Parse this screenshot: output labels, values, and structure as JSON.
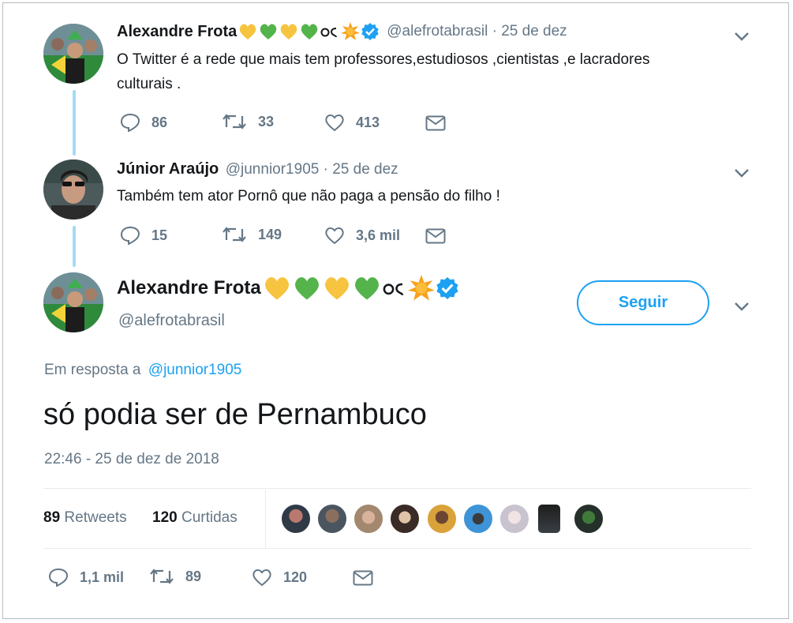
{
  "tweet1": {
    "name": "Alexandre Frota",
    "handle_date": "@alefrotabrasil · 25 de dez",
    "text_line1": "O Twitter é a rede que mais tem professores,estudiosos ,cientistas ,e lacradores",
    "text_line2": "culturais .",
    "replies": "86",
    "retweets": "33",
    "likes": "413"
  },
  "tweet2": {
    "name": "Júnior Araújo",
    "handle_date": "@junnior1905 · 25 de dez",
    "text": "Também tem ator Pornô que não paga a pensão do filho !",
    "replies": "15",
    "retweets": "149",
    "likes": "3,6 mil"
  },
  "main": {
    "name": "Alexandre Frota",
    "handle": "@alefrotabrasil",
    "follow_label": "Seguir",
    "reply_prefix": "Em resposta a",
    "reply_to": "@junnior1905",
    "text": "só podia ser de Pernambuco",
    "timestamp": "22:46 - 25 de dez de 2018",
    "stats": {
      "retweets_count": "89",
      "retweets_label": "Retweets",
      "likes_count": "120",
      "likes_label": "Curtidas"
    },
    "actions": {
      "replies": "1,1 mil",
      "retweets": "89",
      "likes": "120"
    }
  },
  "colors": {
    "accent": "#1da1f2",
    "verified": "#1da1f2",
    "heart_yellow": "#f7c43f",
    "heart_green": "#54b44b",
    "muted": "#657786",
    "thread_line": "#a6d9f5"
  },
  "icons": [
    "reply-icon",
    "retweet-icon",
    "like-icon",
    "dm-icon",
    "chevron-down-icon",
    "verified-icon",
    "sun-icon"
  ]
}
